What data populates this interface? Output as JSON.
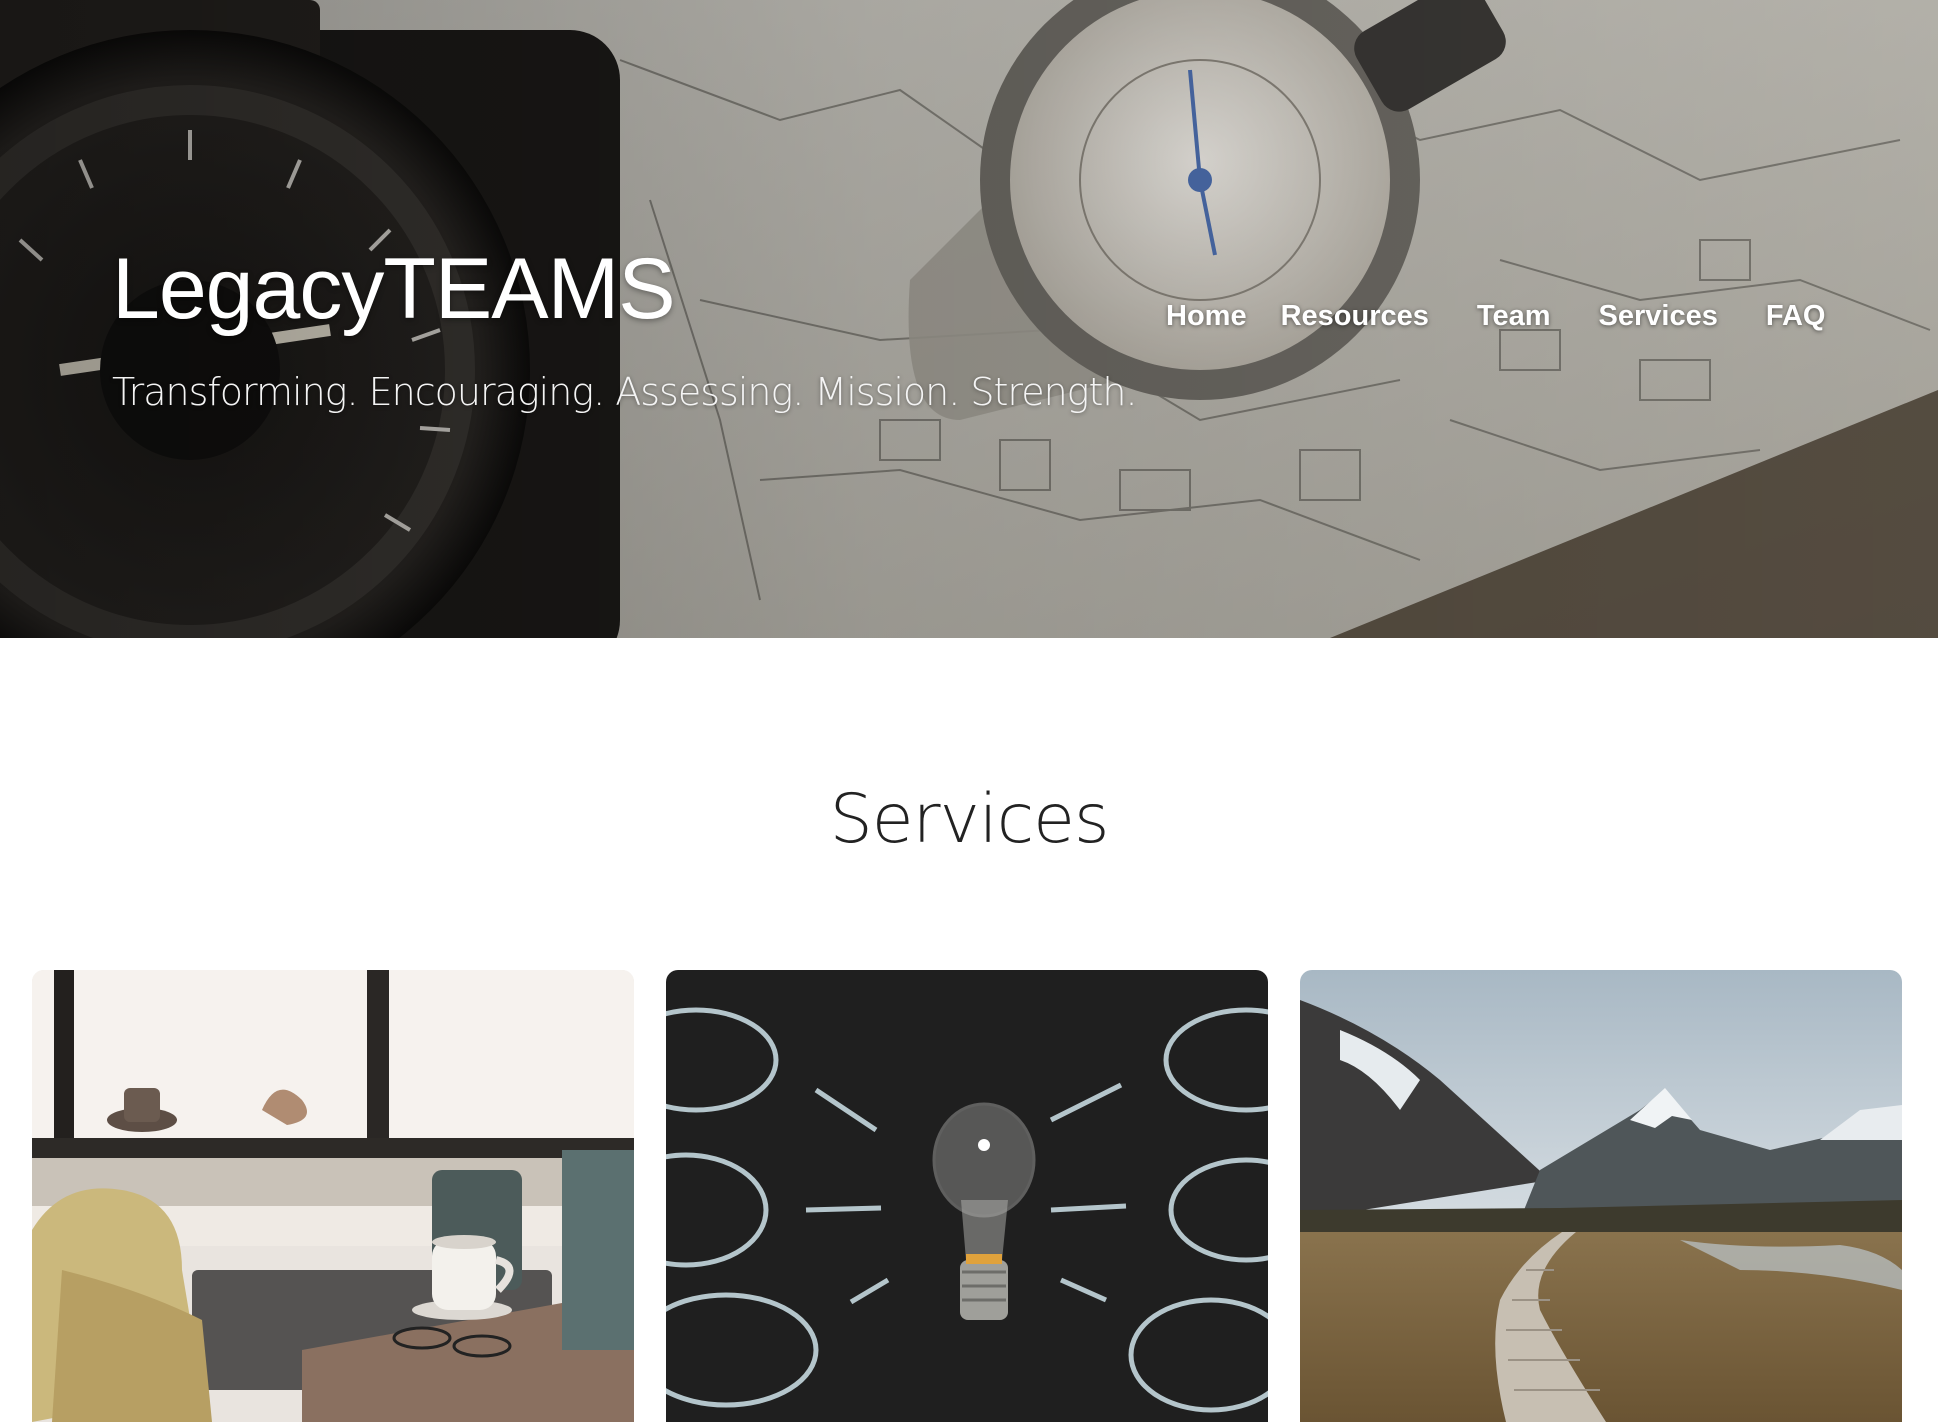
{
  "site": {
    "title": "LegacyTEAMS",
    "tagline": "Transforming. Encouraging. Assessing. Mission. Strength."
  },
  "nav": {
    "items": [
      {
        "label": "Home"
      },
      {
        "label": "Resources"
      },
      {
        "label": "Team"
      },
      {
        "label": "Services"
      },
      {
        "label": "FAQ"
      }
    ]
  },
  "services": {
    "heading": "Services",
    "cards": [
      {
        "image": "office-desk-coffee-image"
      },
      {
        "image": "lightbulb-chalkboard-image"
      },
      {
        "image": "mountain-boardwalk-image"
      }
    ]
  },
  "colors": {
    "text_dark": "#222222",
    "hero_text": "#ffffff",
    "background": "#ffffff"
  }
}
